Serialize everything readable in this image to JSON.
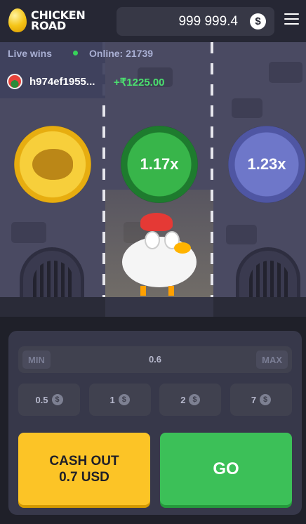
{
  "header": {
    "logo_line1": "CHICKEN",
    "logo_line2": "ROAD",
    "balance": "999 999.4",
    "currency_symbol": "$"
  },
  "live": {
    "label": "Live wins",
    "online_text": "Online: 21739",
    "last_win": {
      "user": "h974ef1955...",
      "amount": "+₹1225.00"
    }
  },
  "lanes": {
    "multipliers": [
      "",
      "1.17x",
      "1.23x"
    ],
    "colors": {
      "passed": "#f7cf3b",
      "current": "#38b54a",
      "next": "#6e77c9"
    }
  },
  "controls": {
    "min_label": "MIN",
    "max_label": "MAX",
    "bet_value": "0.6",
    "quick_bets": [
      "0.5",
      "1",
      "2",
      "7"
    ],
    "currency_symbol": "$",
    "cashout_line1": "CASH OUT",
    "cashout_line2": "0.7 USD",
    "go_label": "GO"
  }
}
